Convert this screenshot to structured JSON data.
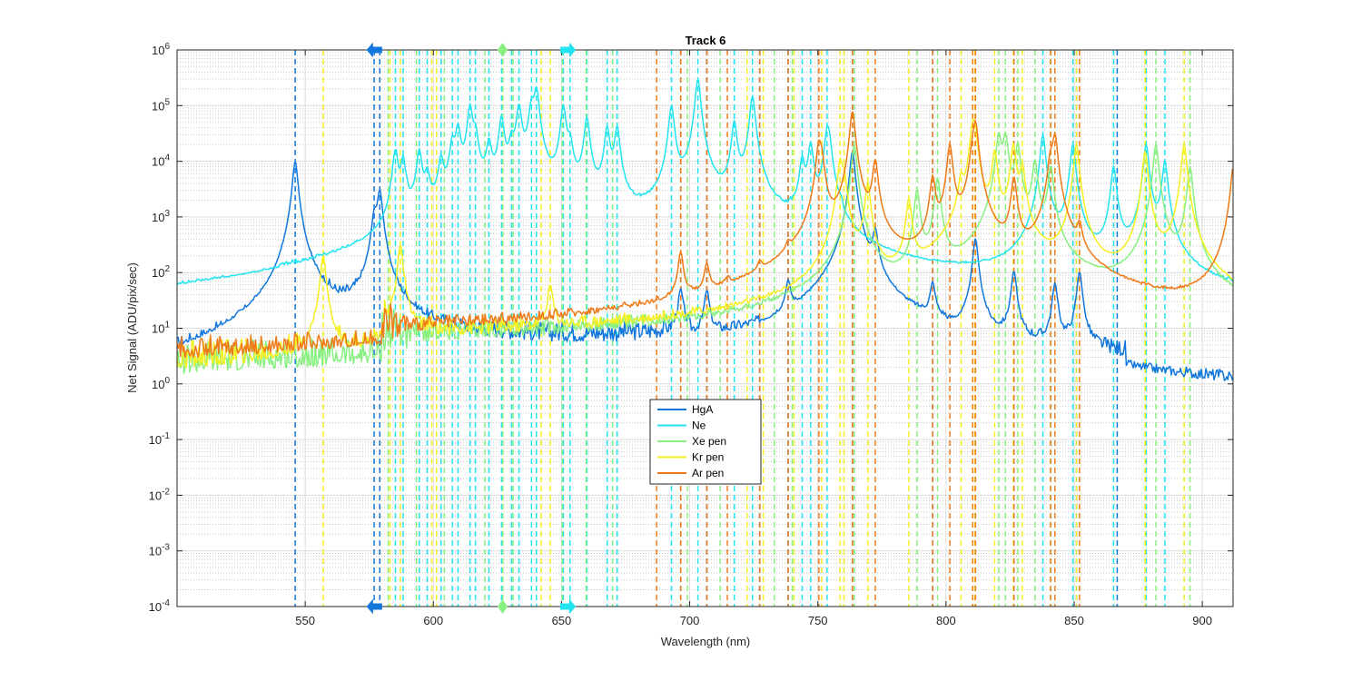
{
  "chart_data": {
    "type": "line",
    "title": "Track 6",
    "xlabel": "Wavelength (nm)",
    "ylabel": "Net Signal (ADU/pix/sec)",
    "xlim": [
      500,
      912
    ],
    "ylim": [
      0.0001,
      1000000
    ],
    "yscale": "log",
    "xticks": [
      550,
      600,
      650,
      700,
      750,
      800,
      850,
      900
    ],
    "xtick_labels": [
      "550",
      "600",
      "650",
      "700",
      "750",
      "800",
      "850",
      "900"
    ],
    "yticks": [
      {
        "exp": -4,
        "base": "10",
        "sup": "-4"
      },
      {
        "exp": -3,
        "base": "10",
        "sup": "-3"
      },
      {
        "exp": -2,
        "base": "10",
        "sup": "-2"
      },
      {
        "exp": -1,
        "base": "10",
        "sup": "-1"
      },
      {
        "exp": 0,
        "base": "10",
        "sup": "0"
      },
      {
        "exp": 1,
        "base": "10",
        "sup": "1"
      },
      {
        "exp": 2,
        "base": "10",
        "sup": "2"
      },
      {
        "exp": 3,
        "base": "10",
        "sup": "3"
      },
      {
        "exp": 4,
        "base": "10",
        "sup": "4"
      },
      {
        "exp": 5,
        "base": "10",
        "sup": "5"
      },
      {
        "exp": 6,
        "base": "10",
        "sup": "6"
      }
    ],
    "grid": "major and minor",
    "legend_position": "bottom-center",
    "series": [
      {
        "name": "HgA",
        "color": "#1177dd",
        "baseline": 5,
        "peaks": [
          [
            546.1,
            10000
          ],
          [
            577.0,
            1000
          ],
          [
            579.1,
            3000
          ],
          [
            696.5,
            40
          ],
          [
            706.7,
            40
          ],
          [
            738.4,
            50
          ],
          [
            763.5,
            15000
          ],
          [
            772.4,
            500
          ],
          [
            794.8,
            50
          ],
          [
            811.5,
            400
          ],
          [
            826.5,
            100
          ],
          [
            842.5,
            60
          ],
          [
            852.1,
            100
          ]
        ],
        "lines": [
          546.1,
          576.9,
          579.1,
          696.5,
          706.7,
          727.3,
          738.4,
          763.5,
          794.8,
          811.5,
          826.5,
          850.9,
          866.8
        ]
      },
      {
        "name": "Ne",
        "color": "#22e4f0",
        "baseline": 200,
        "peaks": [
          [
            585.2,
            15000
          ],
          [
            588.2,
            10000
          ],
          [
            594.5,
            15000
          ],
          [
            597.6,
            5000
          ],
          [
            603.0,
            10000
          ],
          [
            607.4,
            20000
          ],
          [
            609.6,
            40000
          ],
          [
            614.3,
            100000
          ],
          [
            616.4,
            30000
          ],
          [
            621.7,
            20000
          ],
          [
            626.6,
            60000
          ],
          [
            630.5,
            20000
          ],
          [
            633.4,
            100000
          ],
          [
            638.3,
            100000
          ],
          [
            640.2,
            200000
          ],
          [
            650.7,
            100000
          ],
          [
            653.3,
            20000
          ],
          [
            659.9,
            60000
          ],
          [
            667.8,
            40000
          ],
          [
            671.7,
            40000
          ],
          [
            692.9,
            100000
          ],
          [
            703.2,
            300000
          ],
          [
            717.4,
            50000
          ],
          [
            724.5,
            150000
          ],
          [
            743.9,
            10000
          ],
          [
            747.2,
            20000
          ],
          [
            753.6,
            30000
          ],
          [
            754.4,
            20000
          ],
          [
            837.8,
            30000
          ],
          [
            849.5,
            20000
          ],
          [
            865.4,
            8000
          ],
          [
            878.1,
            20000
          ],
          [
            885.4,
            10000
          ]
        ],
        "lines": [
          585.2,
          588.2,
          594.5,
          597.6,
          603.0,
          607.4,
          609.6,
          614.3,
          616.4,
          621.7,
          626.6,
          630.5,
          633.4,
          638.3,
          640.2,
          650.7,
          653.3,
          659.9,
          667.8,
          671.7,
          692.9,
          703.2,
          717.4,
          724.5,
          743.9,
          747.2,
          753.6,
          837.8,
          849.5,
          865.4,
          878.1,
          885.4
        ]
      },
      {
        "name": "Xe pen",
        "color": "#88f080",
        "baseline": 6,
        "peaks": [
          [
            764.2,
            20000
          ],
          [
            788.7,
            3000
          ],
          [
            796.7,
            5000
          ],
          [
            820.6,
            30000
          ],
          [
            823.2,
            30000
          ],
          [
            828.0,
            20000
          ],
          [
            834.7,
            10000
          ],
          [
            840.9,
            8000
          ],
          [
            881.9,
            20000
          ],
          [
            895.2,
            8000
          ]
        ],
        "lines": [
          582.4,
          593.4,
          604.3,
          620.1,
          627.1,
          631.1,
          650.3,
          659.6,
          669.9,
          699.1,
          711.9,
          733.0,
          740.0,
          764.2,
          788.7,
          796.7,
          820.6,
          823.2,
          828.0,
          834.7,
          840.9,
          881.9,
          895.2
        ]
      },
      {
        "name": "Kr pen",
        "color": "#f5f020",
        "baseline": 6,
        "peaks": [
          [
            557.0,
            200
          ],
          [
            587.1,
            300
          ],
          [
            645.6,
            50
          ],
          [
            758.7,
            10000
          ],
          [
            760.2,
            5000
          ],
          [
            769.5,
            4000
          ],
          [
            785.5,
            2000
          ],
          [
            805.9,
            4000
          ],
          [
            810.4,
            40000
          ],
          [
            811.3,
            30000
          ],
          [
            819.0,
            15000
          ],
          [
            826.3,
            20000
          ],
          [
            829.8,
            8000
          ],
          [
            850.9,
            20000
          ],
          [
            877.7,
            15000
          ],
          [
            892.9,
            20000
          ]
        ],
        "lines": [
          557.0,
          583.1,
          587.1,
          599.4,
          601.2,
          642.1,
          645.6,
          722.4,
          728.7,
          740.7,
          751.5,
          758.7,
          760.2,
          769.5,
          785.5,
          805.9,
          810.4,
          811.3,
          819.0,
          826.3,
          829.8,
          850.9,
          877.7,
          892.9
        ]
      },
      {
        "name": "Ar pen",
        "color": "#f07a18",
        "baseline": 6,
        "peaks": [
          [
            696.5,
            200
          ],
          [
            706.7,
            100
          ],
          [
            714.7,
            20
          ],
          [
            727.3,
            50
          ],
          [
            738.4,
            100
          ],
          [
            750.4,
            20000
          ],
          [
            751.5,
            10000
          ],
          [
            763.5,
            80000
          ],
          [
            772.4,
            10000
          ],
          [
            794.8,
            5000
          ],
          [
            801.5,
            20000
          ],
          [
            810.4,
            10000
          ],
          [
            811.5,
            50000
          ],
          [
            826.5,
            5000
          ],
          [
            840.8,
            10000
          ],
          [
            842.5,
            30000
          ],
          [
            852.1,
            500
          ],
          [
            912.3,
            10000
          ]
        ],
        "lines": [
          687.1,
          696.5,
          706.7,
          714.7,
          727.3,
          738.4,
          750.4,
          763.5,
          772.4,
          794.8,
          801.5,
          810.4,
          811.5,
          826.5,
          840.8,
          842.5,
          852.1
        ]
      }
    ],
    "markers": [
      {
        "series": "HgA",
        "x": 577.0,
        "shape": "arrow-left"
      },
      {
        "series": "Xe pen",
        "x": 627.0,
        "shape": "diamond"
      },
      {
        "series": "Ne",
        "x": 652.5,
        "shape": "arrow-right"
      }
    ]
  }
}
